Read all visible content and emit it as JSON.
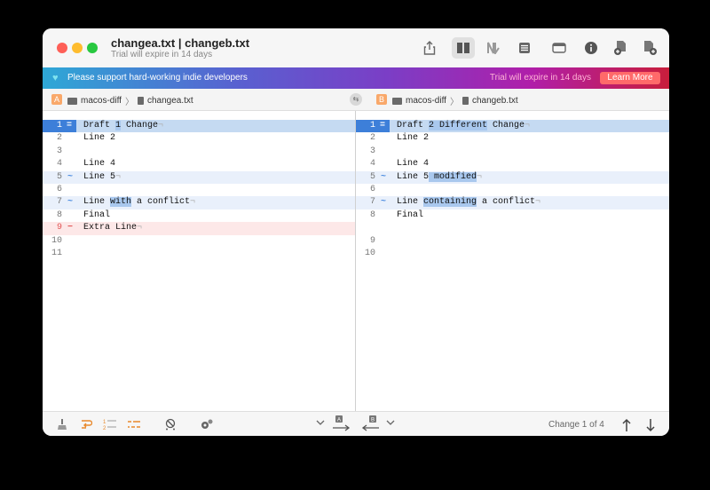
{
  "window": {
    "title": "changea.txt | changeb.txt",
    "subtitle": "Trial will expire in 14 days"
  },
  "toolbar": {
    "icons": [
      "share-icon",
      "side-by-side-icon",
      "unified-icon",
      "list-icon",
      "window-icon",
      "info-icon",
      "add-file-left-icon",
      "add-file-right-icon"
    ]
  },
  "banner": {
    "message": "Please support hard-working indie developers",
    "trial": "Trial will expire in 14 days",
    "button": "Learn More",
    "heart": "♥"
  },
  "path": {
    "left": {
      "tag": "A",
      "folder": "macos-diff",
      "sep": "〉",
      "file": "changea.txt"
    },
    "right": {
      "tag": "B",
      "folder": "macos-diff",
      "sep": "〉",
      "file": "changeb.txt"
    }
  },
  "left_lines": [
    {
      "n": "1",
      "mark": "=",
      "type": "sel",
      "pre": "Draft ",
      "hl": "1",
      "post": " Change",
      "eol": "¬"
    },
    {
      "n": "2",
      "mark": "",
      "type": "",
      "pre": "Line 2",
      "hl": "",
      "post": "",
      "eol": ""
    },
    {
      "n": "3",
      "mark": "",
      "type": "",
      "pre": "",
      "hl": "",
      "post": "",
      "eol": ""
    },
    {
      "n": "4",
      "mark": "",
      "type": "",
      "pre": "Line 4",
      "hl": "",
      "post": "",
      "eol": ""
    },
    {
      "n": "5",
      "mark": "~",
      "type": "change",
      "pre": "Line 5",
      "hl": "",
      "post": "",
      "eol": "¬"
    },
    {
      "n": "6",
      "mark": "",
      "type": "",
      "pre": "",
      "hl": "",
      "post": "",
      "eol": ""
    },
    {
      "n": "7",
      "mark": "~",
      "type": "change",
      "pre": "Line ",
      "hl": "with",
      "post": " a conflict",
      "eol": "¬"
    },
    {
      "n": "8",
      "mark": "",
      "type": "",
      "pre": "Final",
      "hl": "",
      "post": "",
      "eol": ""
    },
    {
      "n": "9",
      "mark": "−",
      "type": "del",
      "pre": "Extra Line",
      "hl": "",
      "post": "",
      "eol": "¬"
    },
    {
      "n": "10",
      "mark": "",
      "type": "",
      "pre": "",
      "hl": "",
      "post": "",
      "eol": ""
    },
    {
      "n": "11",
      "mark": "",
      "type": "",
      "pre": "",
      "hl": "",
      "post": "",
      "eol": ""
    }
  ],
  "right_lines": [
    {
      "n": "1",
      "mark": "=",
      "type": "sel",
      "pre": "Draft ",
      "hl": "2 Different",
      "post": " Change",
      "eol": "¬"
    },
    {
      "n": "2",
      "mark": "",
      "type": "",
      "pre": "Line 2",
      "hl": "",
      "post": "",
      "eol": ""
    },
    {
      "n": "3",
      "mark": "",
      "type": "",
      "pre": "",
      "hl": "",
      "post": "",
      "eol": ""
    },
    {
      "n": "4",
      "mark": "",
      "type": "",
      "pre": "Line 4",
      "hl": "",
      "post": "",
      "eol": ""
    },
    {
      "n": "5",
      "mark": "~",
      "type": "change",
      "pre": "Line 5",
      "hl": " modified",
      "post": "",
      "eol": "¬"
    },
    {
      "n": "6",
      "mark": "",
      "type": "",
      "pre": "",
      "hl": "",
      "post": "",
      "eol": ""
    },
    {
      "n": "7",
      "mark": "~",
      "type": "change",
      "pre": "Line ",
      "hl": "containing",
      "post": " a conflict",
      "eol": "¬"
    },
    {
      "n": "8",
      "mark": "",
      "type": "",
      "pre": "Final",
      "hl": "",
      "post": "",
      "eol": ""
    },
    {
      "n": "",
      "mark": "",
      "type": "",
      "pre": "",
      "hl": "",
      "post": "",
      "eol": ""
    },
    {
      "n": "9",
      "mark": "",
      "type": "",
      "pre": "",
      "hl": "",
      "post": "",
      "eol": ""
    },
    {
      "n": "10",
      "mark": "",
      "type": "",
      "pre": "",
      "hl": "",
      "post": "",
      "eol": ""
    }
  ],
  "bottom": {
    "status": "Change 1 of 4",
    "tag_a": "A",
    "tag_b": "B"
  }
}
